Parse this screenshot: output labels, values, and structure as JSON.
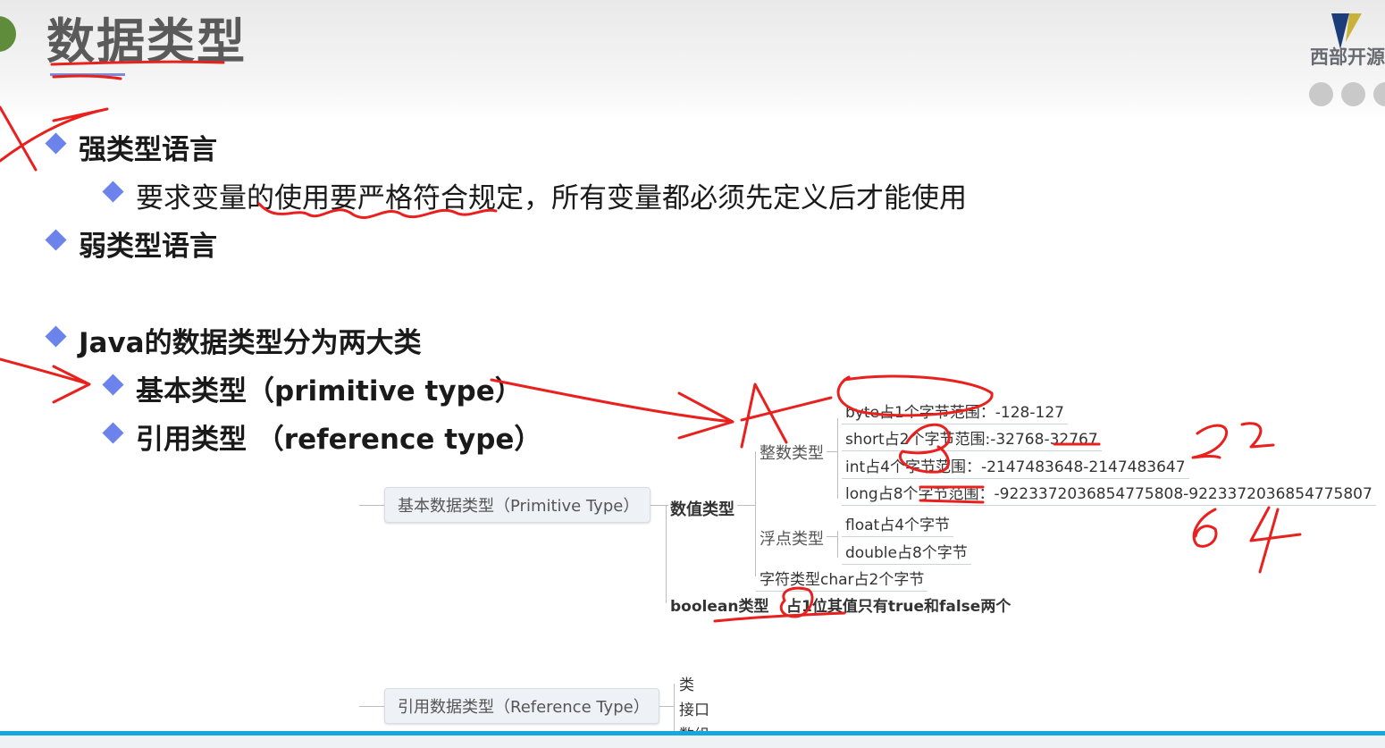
{
  "title": "数据类型",
  "logo": {
    "text": "西部开源"
  },
  "bullets": {
    "strong": "强类型语言",
    "strong_desc": "要求变量的使用要严格符合规定，所有变量都必须先定义后才能使用",
    "weak": "弱类型语言",
    "java_types": "Java的数据类型分为两大类",
    "primitive": "基本类型（primitive type）",
    "reference": "引用类型 （reference type）"
  },
  "mindmap": {
    "primitive_root": "基本数据类型（Primitive Type）",
    "numeric": "数值类型",
    "integer_types": "整数类型",
    "integer_leaves": [
      "byte占1个字节范围：-128-127",
      "short占2个字节范围:-32768-32767",
      "int占4个字节范围：-2147483648-2147483647",
      "long占8个字节范围：-9223372036854775808-9223372036854775807"
    ],
    "float_types": "浮点类型",
    "float_leaves": [
      "float占4个字节",
      "double占8个字节"
    ],
    "char_type": "字符类型char占2个字节",
    "boolean_type": "boolean类型",
    "boolean_desc": "占1位其值只有true和false两个",
    "reference_root": "引用数据类型（Reference Type）",
    "reference_leaves": [
      "类",
      "接口",
      "数组"
    ]
  },
  "annotations": [
    "32",
    "64"
  ],
  "colors": {
    "accent": "#6b83ea",
    "ink": "#e8201e",
    "progress": "#15a8e0"
  }
}
